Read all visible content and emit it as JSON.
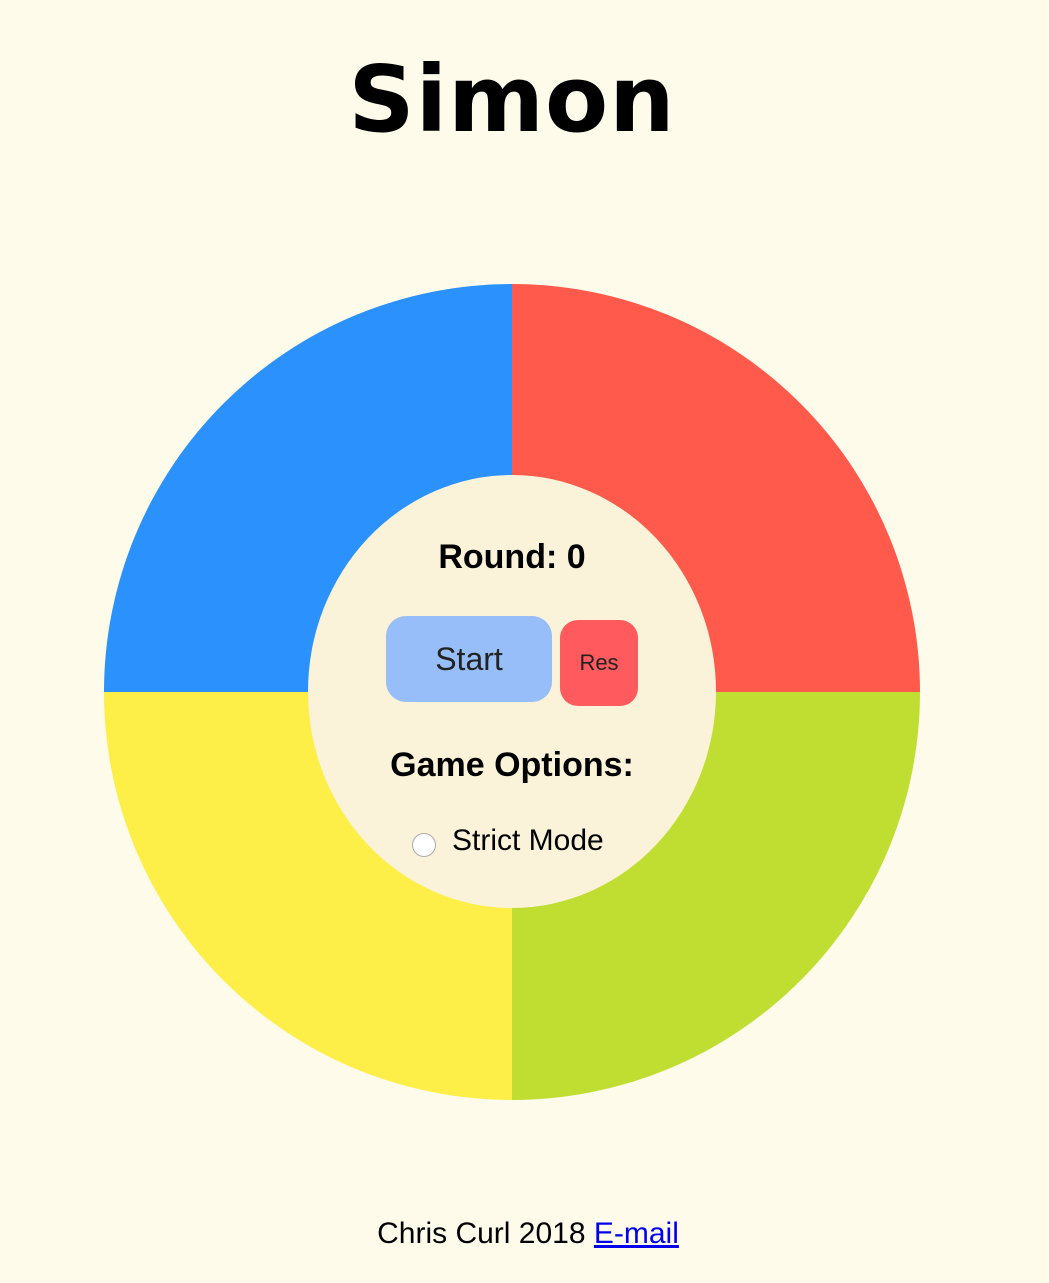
{
  "title": "Simon",
  "pads": {
    "top_left": {
      "color": "#2a91fd"
    },
    "top_right": {
      "color": "#ff5a4b"
    },
    "bottom_left": {
      "color": "#fdee48"
    },
    "bottom_right": {
      "color": "#c0dd31"
    }
  },
  "center": {
    "round_text": "Round: 0",
    "start_label": "Start",
    "start_color": "#97bef8",
    "reset_label": "Res",
    "reset_color": "#ff5a5e",
    "options_heading": "Game Options:",
    "strict_label": "Strict Mode",
    "strict_checked": false
  },
  "footer": {
    "text": "Chris Curl 2018",
    "link_label": "E-mail"
  }
}
